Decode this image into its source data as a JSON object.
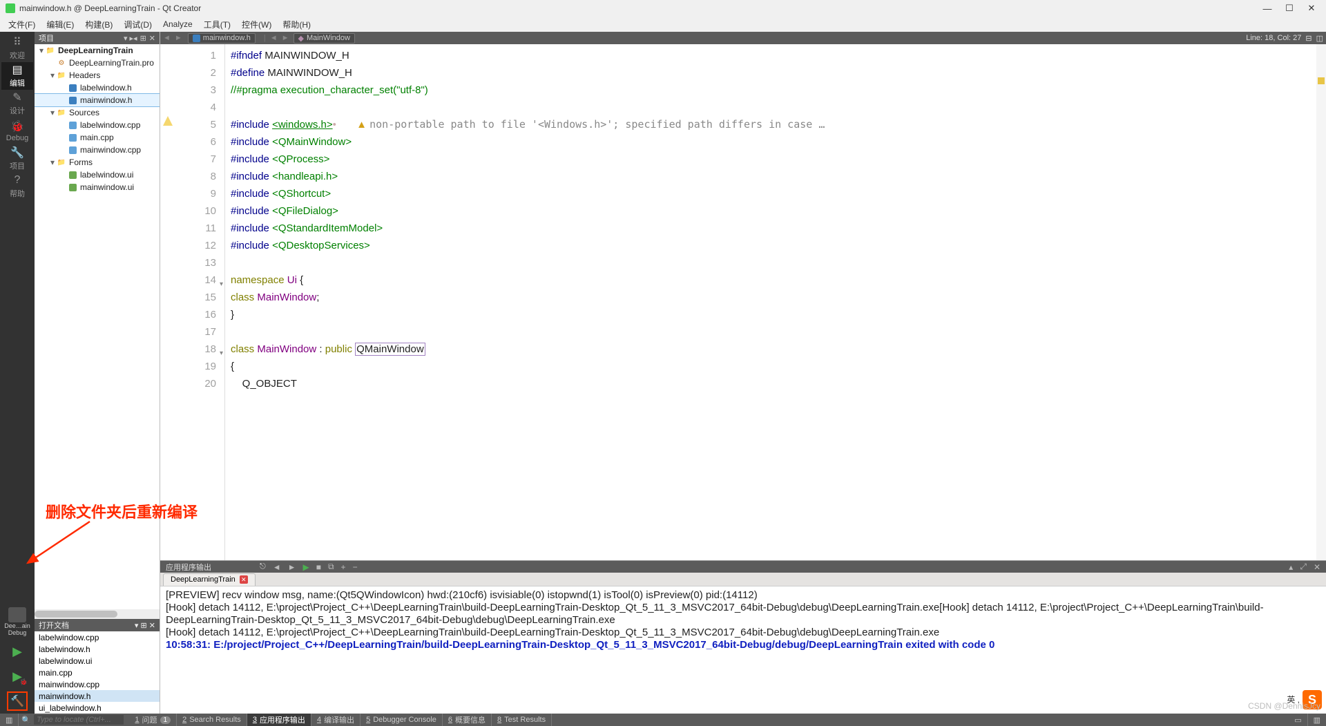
{
  "title": "mainwindow.h @ DeepLearningTrain - Qt Creator",
  "menus": [
    "文件(F)",
    "编辑(E)",
    "构建(B)",
    "调试(D)",
    "Analyze",
    "工具(T)",
    "控件(W)",
    "帮助(H)"
  ],
  "modes": [
    {
      "label": "欢迎",
      "icon": "⠿"
    },
    {
      "label": "编辑",
      "icon": "▤",
      "active": true
    },
    {
      "label": "设计",
      "icon": "✎"
    },
    {
      "label": "Debug",
      "icon": "🐞"
    },
    {
      "label": "项目",
      "icon": "🔧"
    },
    {
      "label": "帮助",
      "icon": "?"
    }
  ],
  "kit": {
    "name": "Dee…ain",
    "config": "Debug"
  },
  "project_header": "项目",
  "tree": [
    {
      "d": 0,
      "arrow": "▾",
      "icon": "fld",
      "label": "DeepLearningTrain",
      "bold": true
    },
    {
      "d": 1,
      "arrow": "",
      "icon": "gear",
      "label": "DeepLearningTrain.pro"
    },
    {
      "d": 1,
      "arrow": "▾",
      "icon": "fld",
      "label": "Headers"
    },
    {
      "d": 2,
      "arrow": "",
      "icon": "h",
      "label": "labelwindow.h"
    },
    {
      "d": 2,
      "arrow": "",
      "icon": "h",
      "label": "mainwindow.h",
      "sel": true
    },
    {
      "d": 1,
      "arrow": "▾",
      "icon": "fld",
      "label": "Sources"
    },
    {
      "d": 2,
      "arrow": "",
      "icon": "cpp",
      "label": "labelwindow.cpp"
    },
    {
      "d": 2,
      "arrow": "",
      "icon": "cpp",
      "label": "main.cpp"
    },
    {
      "d": 2,
      "arrow": "",
      "icon": "cpp",
      "label": "mainwindow.cpp"
    },
    {
      "d": 1,
      "arrow": "▾",
      "icon": "fld",
      "label": "Forms"
    },
    {
      "d": 2,
      "arrow": "",
      "icon": "ui",
      "label": "labelwindow.ui"
    },
    {
      "d": 2,
      "arrow": "",
      "icon": "ui",
      "label": "mainwindow.ui"
    }
  ],
  "open_docs_header": "打开文档",
  "open_docs": [
    {
      "label": "labelwindow.cpp"
    },
    {
      "label": "labelwindow.h"
    },
    {
      "label": "labelwindow.ui"
    },
    {
      "label": "main.cpp"
    },
    {
      "label": "mainwindow.cpp"
    },
    {
      "label": "mainwindow.h",
      "sel": true
    },
    {
      "label": "ui_labelwindow.h"
    }
  ],
  "editor_tabs": {
    "file": "mainwindow.h",
    "symbol": "MainWindow"
  },
  "linecol": "Line: 18, Col: 27",
  "code_lines": [
    {
      "n": 1,
      "html": "<span class='k-pre'>#ifndef</span> MAINWINDOW_H"
    },
    {
      "n": 2,
      "html": "<span class='k-pre'>#define</span> MAINWINDOW_H"
    },
    {
      "n": 3,
      "html": "<span class='k-cmt'>//#pragma execution_character_set(\"utf-8\")</span>"
    },
    {
      "n": 4,
      "html": ""
    },
    {
      "n": 5,
      "warn": true,
      "html": "<span class='k-pre'>#include</span> <span class='k-inc'>&lt;windows.h&gt;</span><span style='color:#caa'>•</span>       <span class='warn-tri'>▲</span> <span class='warn-inline'>non-portable path to file '&lt;Windows.h&gt;'; specified path differs in case …</span>"
    },
    {
      "n": 6,
      "html": "<span class='k-pre'>#include</span> <span class='k-incn'>&lt;QMainWindow&gt;</span>"
    },
    {
      "n": 7,
      "html": "<span class='k-pre'>#include</span> <span class='k-incn'>&lt;QProcess&gt;</span>"
    },
    {
      "n": 8,
      "html": "<span class='k-pre'>#include</span> <span class='k-incn'>&lt;handleapi.h&gt;</span>"
    },
    {
      "n": 9,
      "html": "<span class='k-pre'>#include</span> <span class='k-incn'>&lt;QShortcut&gt;</span>"
    },
    {
      "n": 10,
      "html": "<span class='k-pre'>#include</span> <span class='k-incn'>&lt;QFileDialog&gt;</span>"
    },
    {
      "n": 11,
      "html": "<span class='k-pre'>#include</span> <span class='k-incn'>&lt;QStandardItemModel&gt;</span>"
    },
    {
      "n": 12,
      "html": "<span class='k-pre'>#include</span> <span class='k-incn'>&lt;QDesktopServices&gt;</span>"
    },
    {
      "n": 13,
      "html": ""
    },
    {
      "n": 14,
      "fold": true,
      "html": "<span class='k-olive'>namespace</span> <span class='k-type'>Ui</span> {"
    },
    {
      "n": 15,
      "html": "<span class='k-olive'>class</span> <span class='k-type'>MainWindow</span>;"
    },
    {
      "n": 16,
      "html": "}"
    },
    {
      "n": 17,
      "html": ""
    },
    {
      "n": 18,
      "fold": true,
      "html": "<span class='k-olive'>class</span> <span class='k-type'>MainWindow</span> : <span class='k-olive'>public</span> <span class='cursor-box'>QMainWindow</span>"
    },
    {
      "n": 19,
      "html": "{"
    },
    {
      "n": 20,
      "html": "    Q_OBJECT"
    }
  ],
  "output": {
    "panel_title": "应用程序输出",
    "tab": "DeepLearningTrain",
    "lines": [
      "[PREVIEW] recv window msg, name:(Qt5QWindowIcon) hwd:(210cf6) isvisiable(0) istopwnd(1) isTool(0) isPreview(0) pid:(14112)",
      "[Hook] detach 14112, E:\\project\\Project_C++\\DeepLearningTrain\\build-DeepLearningTrain-Desktop_Qt_5_11_3_MSVC2017_64bit-Debug\\debug\\DeepLearningTrain.exe[Hook] detach 14112, E:\\project\\Project_C++\\DeepLearningTrain\\build-DeepLearningTrain-Desktop_Qt_5_11_3_MSVC2017_64bit-Debug\\debug\\DeepLearningTrain.exe",
      "[Hook] detach 14112, E:\\project\\Project_C++\\DeepLearningTrain\\build-DeepLearningTrain-Desktop_Qt_5_11_3_MSVC2017_64bit-Debug\\debug\\DeepLearningTrain.exe"
    ],
    "exit": "10:58:31: E:/project/Project_C++/DeepLearningTrain/build-DeepLearningTrain-Desktop_Qt_5_11_3_MSVC2017_64bit-Debug/debug/DeepLearningTrain exited with code 0"
  },
  "status_tabs": [
    {
      "k": "1",
      "label": "问题",
      "badge": "1"
    },
    {
      "k": "2",
      "label": "Search Results"
    },
    {
      "k": "3",
      "label": "应用程序输出",
      "active": true
    },
    {
      "k": "4",
      "label": "编译输出"
    },
    {
      "k": "5",
      "label": "Debugger Console"
    },
    {
      "k": "6",
      "label": "概要信息"
    },
    {
      "k": "8",
      "label": "Test Results"
    }
  ],
  "locator_ph": "Type to locate (Ctrl+...",
  "annotation_text": "删除文件夹后重新编译",
  "watermark": "CSDN @DennisJcy",
  "sogou_label": "英 ,"
}
